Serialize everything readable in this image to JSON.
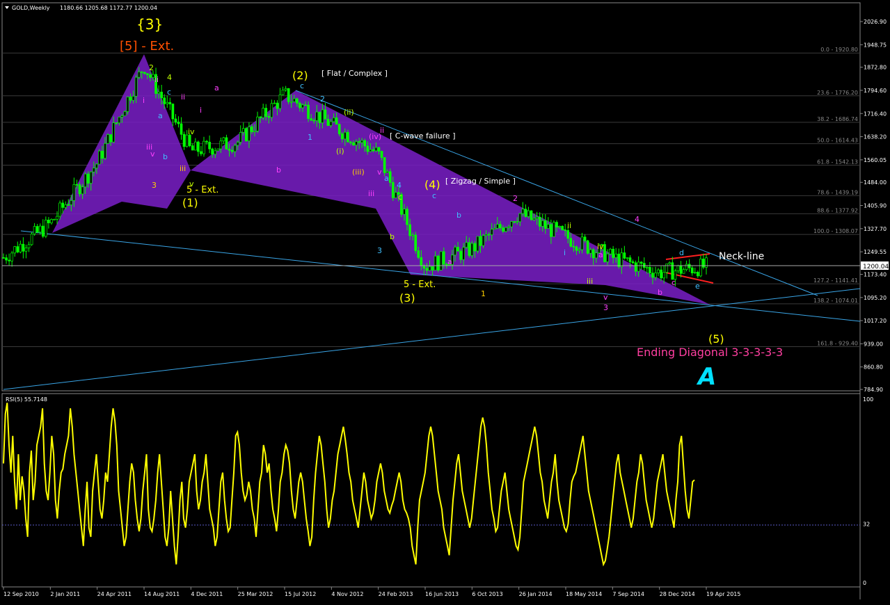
{
  "window": {
    "title": "GOLD,Weekly",
    "ohlc": "1180.66 1205.68 1172.77 1200.04",
    "current_price": "1200.04"
  },
  "colors": {
    "background": "#000000",
    "grid": "#3a3a3a",
    "candle": "#00ff00",
    "wedge": "#7a1fc8",
    "trendline": "#3aa6e8",
    "rsi_line": "#ffff00",
    "rsi_level": "#5a5ac8",
    "neckline": "#ff2020"
  },
  "chart_data": [
    {
      "type": "candlestick",
      "title": "GOLD,Weekly",
      "ylim": [
        784.9,
        2065
      ],
      "y_ticks": [
        "2026.90",
        "1948.75",
        "1872.80",
        "1794.60",
        "1716.40",
        "1638.20",
        "1560.05",
        "1484.00",
        "1405.90",
        "1327.70",
        "1249.55",
        "1173.40",
        "1095.20",
        "1017.20",
        "939.00",
        "860.80",
        "784.90"
      ],
      "x_ticks": [
        "12 Sep 2010",
        "2 Jan 2011",
        "24 Apr 2011",
        "14 Aug 2011",
        "4 Dec 2011",
        "25 Mar 2012",
        "15 Jul 2012",
        "4 Nov 2012",
        "24 Feb 2013",
        "16 Jun 2013",
        "6 Oct 2013",
        "26 Jan 2014",
        "18 May 2014",
        "7 Sep 2014",
        "28 Dec 2014",
        "19 Apr 2015"
      ],
      "fib_levels": [
        {
          "label": "0.0 - 1920.80",
          "value": 1920.8
        },
        {
          "label": "23.6 - 1776.20",
          "value": 1776.2
        },
        {
          "label": "38.2 - 1686.74",
          "value": 1686.74
        },
        {
          "label": "50.0 - 1614.43",
          "value": 1614.43
        },
        {
          "label": "61.8 - 1542.13",
          "value": 1542.13
        },
        {
          "label": "78.6 - 1439.19",
          "value": 1439.19
        },
        {
          "label": "88.6 - 1377.92",
          "value": 1377.92
        },
        {
          "label": "100.0 - 1308.07",
          "value": 1308.07
        },
        {
          "label": "127.2 - 1141.41",
          "value": 1141.41
        },
        {
          "label": "138.2 - 1074.01",
          "value": 1074.01
        },
        {
          "label": "161.8 - 929.40",
          "value": 929.4
        }
      ],
      "close_path": [
        [
          "12 Sep 2010",
          1230
        ],
        [
          "2 Jan 2011",
          1345
        ],
        [
          "24 Apr 2011",
          1550
        ],
        [
          "14 Aug 2011",
          1880
        ],
        [
          "4 Dec 2011",
          1590
        ],
        [
          "25 Mar 2012",
          1620
        ],
        [
          "15 Jul 2012",
          1780
        ],
        [
          "4 Nov 2012",
          1680
        ],
        [
          "24 Feb 2013",
          1580
        ],
        [
          "16 Jun 2013",
          1200
        ],
        [
          "6 Oct 2013",
          1260
        ],
        [
          "26 Jan 2014",
          1380
        ],
        [
          "18 May 2014",
          1300
        ],
        [
          "7 Sep 2014",
          1230
        ],
        [
          "28 Dec 2014",
          1180
        ],
        [
          "19 Apr 2015",
          1200
        ]
      ],
      "annotations": [
        {
          "text": "{3}",
          "color": "#ffff00"
        },
        {
          "text": "[5] - Ext.",
          "color": "#ff5000"
        },
        {
          "text": "(2)",
          "color": "#ffff00"
        },
        {
          "text": "[ Flat / Complex ]",
          "color": "#ffffff"
        },
        {
          "text": "[ C-wave failure ]",
          "color": "#ffffff"
        },
        {
          "text": "[ Zigzag / Simple ]",
          "color": "#ffffff"
        },
        {
          "text": "(4)",
          "color": "#ffff00"
        },
        {
          "text": "5 - Ext.",
          "color": "#ffff00"
        },
        {
          "text": "(1)",
          "color": "#ffff00"
        },
        {
          "text": "5 - Ext.",
          "color": "#ffff00"
        },
        {
          "text": "(3)",
          "color": "#ffff00"
        },
        {
          "text": "(5)",
          "color": "#ffff00"
        },
        {
          "text": "Neck-line",
          "color": "#ffffff"
        },
        {
          "text": "Ending Diagonal 3-3-3-3-3",
          "color": "#ff3fa0"
        }
      ],
      "wave_labels": [
        "2",
        "4",
        "3",
        "v",
        "iii",
        "ii",
        "i",
        "a",
        "b",
        "c",
        "iv",
        "v",
        "iii",
        "i",
        "ii",
        "a",
        "b",
        "c",
        "2",
        "1",
        "(i)",
        "(ii)",
        "(iii)",
        "(iv)",
        "ii",
        "iii",
        "v",
        "3",
        "4",
        "a",
        "b",
        "c",
        "1",
        "2",
        "3",
        "4",
        "a",
        "b",
        "c",
        "i",
        "ii",
        "iii",
        "iv",
        "v",
        "a",
        "b",
        "c",
        "d",
        "e"
      ]
    },
    {
      "type": "line",
      "title": "RSI(5) 55.7148",
      "ylim": [
        0,
        100
      ],
      "y_ticks": [
        "100",
        "32",
        "0"
      ],
      "level": 32,
      "series": [
        {
          "name": "RSI(5)",
          "values": [
            65,
            92,
            98,
            75,
            60,
            80,
            55,
            40,
            70,
            45,
            58,
            50,
            35,
            25,
            60,
            72,
            45,
            55,
            75,
            80,
            85,
            95,
            65,
            50,
            45,
            60,
            80,
            70,
            45,
            35,
            50,
            60,
            62,
            70,
            75,
            80,
            95,
            85,
            70,
            60,
            50,
            40,
            30,
            20,
            40,
            55,
            30,
            25,
            50,
            60,
            70,
            55,
            40,
            35,
            45,
            60,
            55,
            70,
            85,
            95,
            88,
            75,
            50,
            40,
            30,
            20,
            25,
            40,
            55,
            65,
            60,
            45,
            35,
            28,
            35,
            50,
            60,
            70,
            40,
            30,
            28,
            35,
            45,
            60,
            70,
            55,
            40,
            25,
            20,
            30,
            50,
            35,
            20,
            10,
            25,
            45,
            55,
            35,
            30,
            40,
            55,
            60,
            65,
            70,
            50,
            40,
            45,
            55,
            60,
            70,
            55,
            40,
            35,
            30,
            20,
            25,
            40,
            55,
            60,
            45,
            35,
            28,
            30,
            45,
            60,
            80,
            82,
            75,
            60,
            50,
            45,
            48,
            55,
            50,
            40,
            35,
            25,
            40,
            55,
            60,
            75,
            70,
            60,
            65,
            50,
            40,
            35,
            28,
            40,
            55,
            60,
            70,
            75,
            72,
            65,
            50,
            40,
            35,
            45,
            55,
            60,
            55,
            45,
            35,
            28,
            20,
            25,
            45,
            60,
            70,
            80,
            75,
            65,
            55,
            40,
            30,
            35,
            45,
            50,
            60,
            70,
            75,
            80,
            85,
            78,
            70,
            60,
            55,
            45,
            40,
            35,
            30,
            40,
            50,
            60,
            55,
            45,
            40,
            35,
            38,
            45,
            55,
            60,
            65,
            60,
            50,
            45,
            40,
            38,
            42,
            45,
            50,
            55,
            60,
            55,
            45,
            40,
            38,
            35,
            30,
            20,
            15,
            10,
            30,
            45,
            50,
            55,
            60,
            70,
            80,
            85,
            80,
            70,
            60,
            50,
            45,
            40,
            30,
            25,
            20,
            15,
            30,
            45,
            55,
            65,
            70,
            60,
            50,
            45,
            40,
            35,
            30,
            35,
            45,
            55,
            65,
            75,
            85,
            90,
            85,
            75,
            60,
            50,
            40,
            35,
            28,
            30,
            40,
            50,
            55,
            60,
            50,
            40,
            35,
            30,
            25,
            20,
            18,
            25,
            40,
            55,
            60,
            65,
            70,
            75,
            80,
            85,
            80,
            70,
            60,
            55,
            45,
            40,
            35,
            45,
            55,
            60,
            70,
            55,
            45,
            40,
            35,
            30,
            28,
            32,
            45,
            55,
            58,
            60,
            65,
            70,
            75,
            80,
            70,
            60,
            50,
            45,
            40,
            35,
            30,
            25,
            20,
            15,
            10,
            12,
            18,
            25,
            35,
            45,
            55,
            65,
            70,
            60,
            55,
            50,
            45,
            40,
            35,
            30,
            35,
            45,
            55,
            60,
            70,
            65,
            55,
            45,
            40,
            35,
            30,
            35,
            45,
            55,
            60,
            65,
            70,
            60,
            50,
            45,
            40,
            35,
            30,
            45,
            55,
            75,
            80,
            65,
            50,
            40,
            35,
            45,
            55,
            56
          ]
        }
      ]
    }
  ]
}
